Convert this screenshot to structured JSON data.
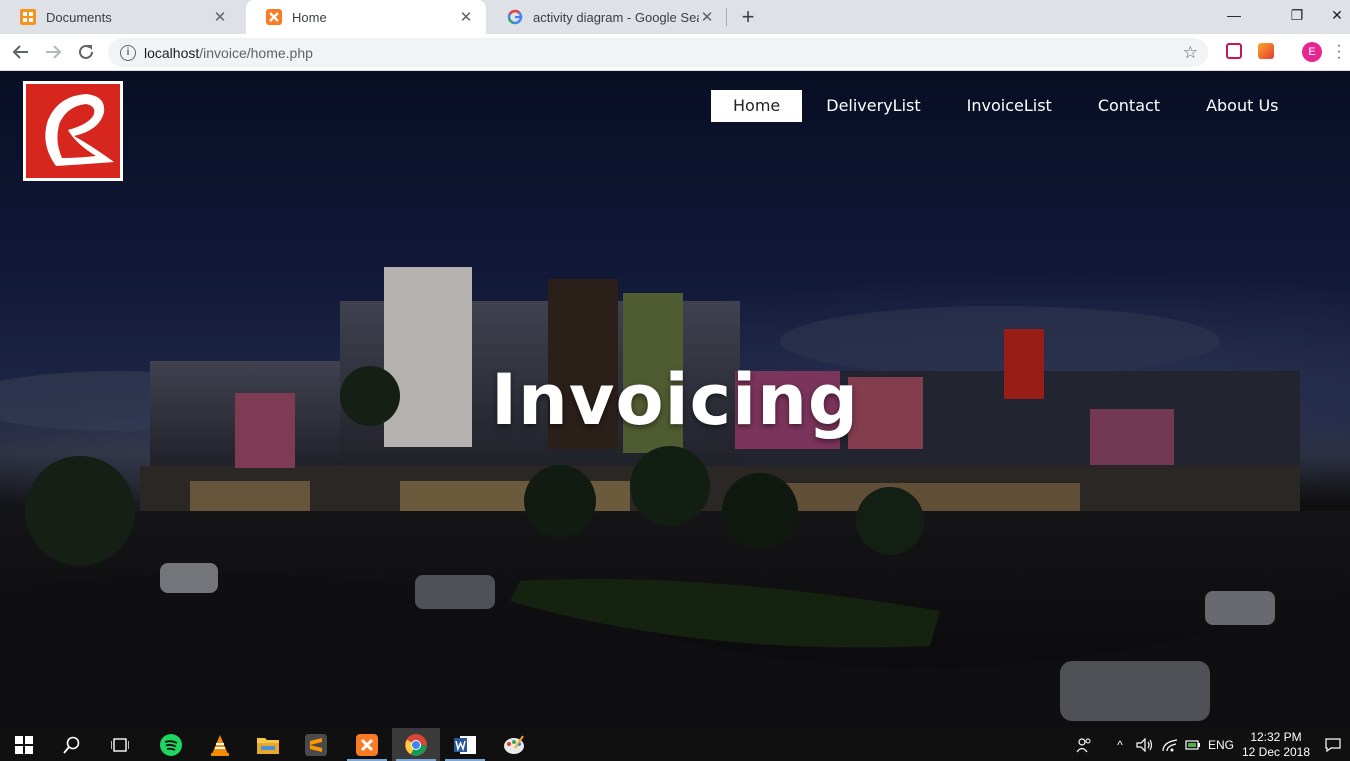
{
  "browser": {
    "tabs": [
      {
        "title": "Documents",
        "favicon": "xampp-folder-icon",
        "active": false
      },
      {
        "title": "Home",
        "favicon": "xampp-icon",
        "active": true
      },
      {
        "title": "activity diagram - Google Search",
        "favicon": "google-icon",
        "active": false
      }
    ],
    "url": {
      "host": "localhost",
      "path": "/invoice/home.php"
    },
    "profile_initial": "E"
  },
  "page": {
    "nav": [
      {
        "label": "Home",
        "active": true
      },
      {
        "label": "DeliveryList",
        "active": false
      },
      {
        "label": "InvoiceList",
        "active": false
      },
      {
        "label": "Contact",
        "active": false
      },
      {
        "label": "About Us",
        "active": false
      }
    ],
    "hero_title": "Invoicing",
    "logo": "robinsons-r-logo"
  },
  "taskbar": {
    "apps": [
      "start",
      "search",
      "task-view",
      "spotify",
      "vlc",
      "file-explorer",
      "sublime-text",
      "xampp",
      "chrome",
      "word",
      "paint"
    ],
    "language": "ENG",
    "time": "12:32 PM",
    "date": "12 Dec 2018"
  },
  "colors": {
    "logo_red": "#d7261e",
    "avatar": "#e52592",
    "nav_active_bg": "#ffffff"
  }
}
